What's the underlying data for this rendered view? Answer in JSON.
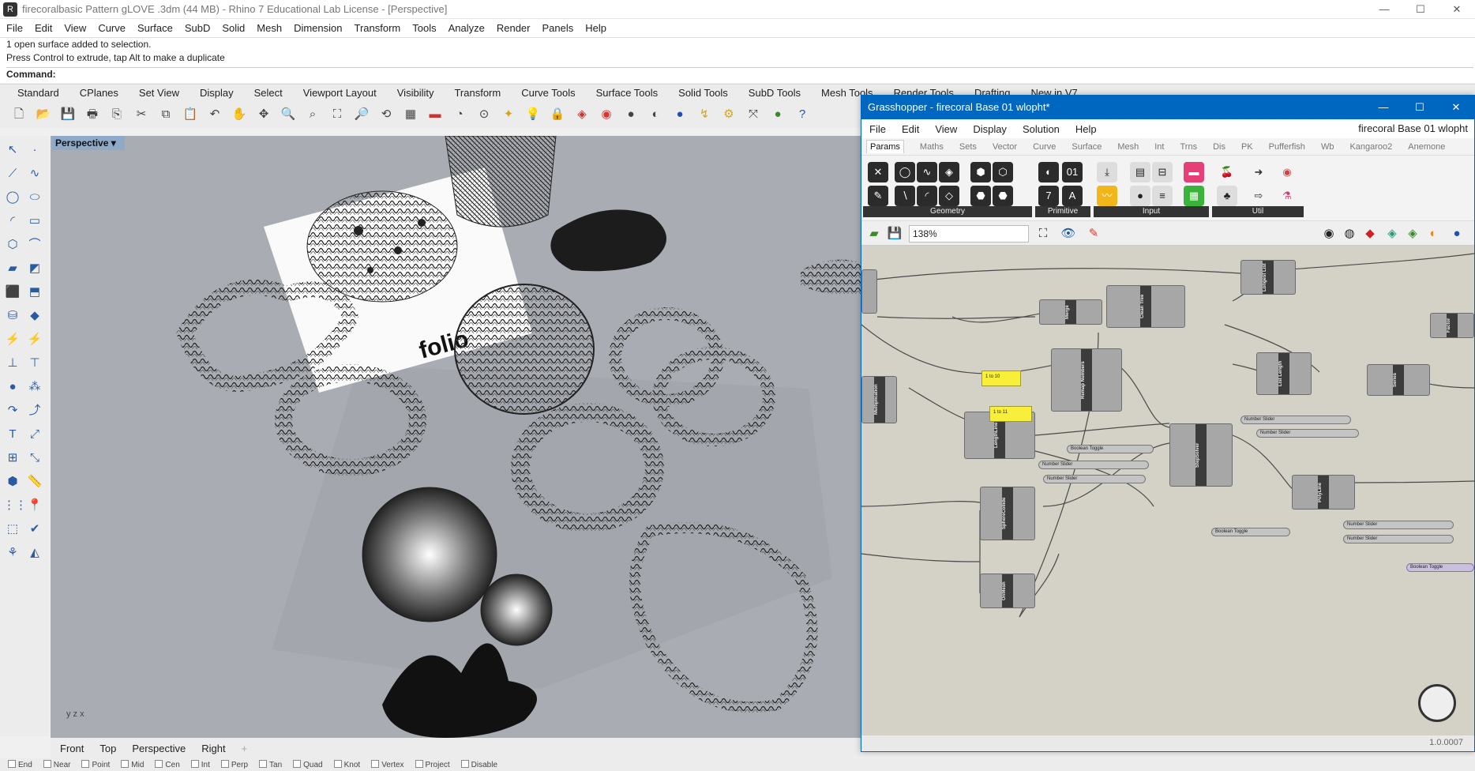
{
  "rhino": {
    "title": "firecoralbasic Pattern gLOVE .3dm (44 MB) - Rhino 7 Educational Lab License - [Perspective]",
    "menu": [
      "File",
      "Edit",
      "View",
      "Curve",
      "Surface",
      "SubD",
      "Solid",
      "Mesh",
      "Dimension",
      "Transform",
      "Tools",
      "Analyze",
      "Render",
      "Panels",
      "Help"
    ],
    "history": [
      "1 open surface added to selection.",
      "Press Control to extrude, tap Alt to make a duplicate"
    ],
    "command_label": "Command:",
    "toolbar_tabs": [
      "Standard",
      "CPlanes",
      "Set View",
      "Display",
      "Select",
      "Viewport Layout",
      "Visibility",
      "Transform",
      "Curve Tools",
      "Surface Tools",
      "Solid Tools",
      "SubD Tools",
      "Mesh Tools",
      "Render Tools",
      "Drafting",
      "New in V7"
    ],
    "viewport_label": "Perspective",
    "viewport_tabs": [
      "Front",
      "Top",
      "Perspective",
      "Right"
    ],
    "osnaps": [
      "End",
      "Near",
      "Point",
      "Mid",
      "Cen",
      "Int",
      "Perp",
      "Tan",
      "Quad",
      "Knot",
      "Vertex",
      "Project",
      "Disable"
    ],
    "paper_text": "folio"
  },
  "gh": {
    "title": "Grasshopper - firecoral Base 01 wlopht*",
    "doc_name": "firecoral Base 01 wlopht",
    "menu": [
      "File",
      "Edit",
      "View",
      "Display",
      "Solution",
      "Help"
    ],
    "tabs": [
      "Params",
      "Maths",
      "Sets",
      "Vector",
      "Curve",
      "Surface",
      "Mesh",
      "Int",
      "Trns",
      "Dis",
      "PK",
      "Pufferfish",
      "Wb",
      "Kangaroo2",
      "Anemone"
    ],
    "ribbon_groups": [
      "Geometry",
      "Primitive",
      "Input",
      "Util"
    ],
    "zoom": "138%",
    "version": "1.0.0007",
    "nodes": {
      "merge": "Merge",
      "clean_tree": "Clean Tree",
      "longest_list": "Longest List",
      "remap": "Remap Numbers",
      "list_length": "List Length",
      "series": "Series",
      "length_line": "LengthLine",
      "step_solver": "StepSolver",
      "sphere_collide": "SphereCollide",
      "polyline": "PolyLine",
      "on_mesh": "OnMesh",
      "multiplication": "Multiplication",
      "factor": "Factor"
    },
    "panels": [
      "1 to 10",
      "1 to 11"
    ],
    "sliders": [
      "Number Slider",
      "Boolean Toggle"
    ]
  }
}
